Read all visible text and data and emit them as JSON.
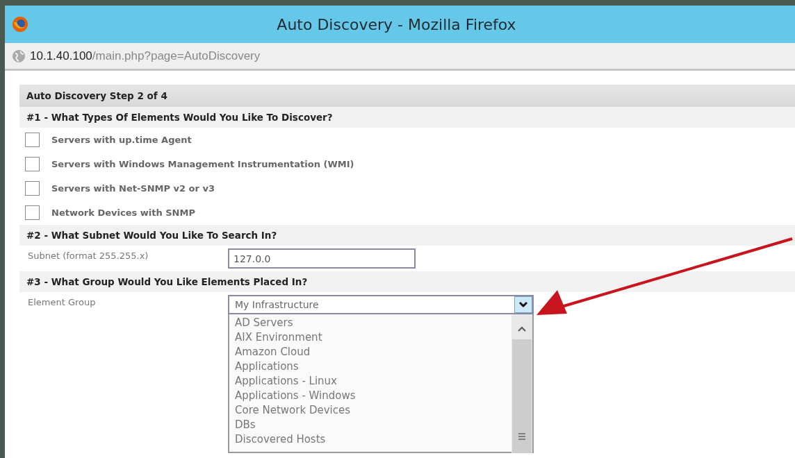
{
  "window": {
    "title": "Auto Discovery - Mozilla Firefox"
  },
  "address_bar": {
    "host": "10.1.40.100",
    "path": "/main.php?page=AutoDiscovery"
  },
  "page": {
    "heading": "Auto Discovery Step 2 of 4",
    "sections": [
      {
        "kind": "checkboxes",
        "title": "#1 - What Types Of Elements Would You Like To Discover?",
        "options": [
          {
            "label": "Servers with up.time Agent",
            "checked": false
          },
          {
            "label": "Servers with Windows Management Instrumentation (WMI)",
            "checked": false
          },
          {
            "label": "Servers with Net-SNMP v2 or v3",
            "checked": false
          },
          {
            "label": "Network Devices with SNMP",
            "checked": false
          }
        ]
      },
      {
        "kind": "text",
        "title": "#2 - What Subnet Would You Like To Search In?",
        "label": "Subnet (format 255.255.x)",
        "value": "127.0.0"
      },
      {
        "kind": "select",
        "title": "#3 - What Group Would You Like Elements Placed In?",
        "label": "Element Group",
        "value": "My Infrastructure",
        "expanded": true,
        "options": [
          "AD Servers",
          "AIX Environment",
          "Amazon Cloud",
          "Applications",
          "Applications - Linux",
          "Applications - Windows",
          "Core Network Devices",
          "DBs",
          "Discovered Hosts"
        ]
      }
    ]
  }
}
